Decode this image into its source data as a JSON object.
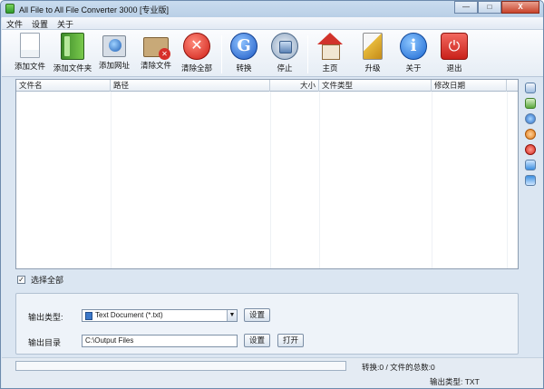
{
  "window": {
    "title": "All File to All File Converter 3000 [专业版]",
    "controls": {
      "minimize": "—",
      "maximize": "□",
      "close": "X"
    }
  },
  "menu": [
    "文件",
    "设置",
    "关于"
  ],
  "toolbar": {
    "add_file": "添加文件",
    "add_folder": "添加文件夹",
    "add_url": "添加网址",
    "clear_files": "清除文件",
    "clear_all": "清除全部",
    "convert": "转换",
    "stop": "停止",
    "home": "主页",
    "upgrade": "升级",
    "about": "关于",
    "exit": "退出"
  },
  "toolbar_glyphs": {
    "clear_all": "✕",
    "convert": "G",
    "about": "i"
  },
  "filelist": {
    "columns": [
      "文件名",
      "路径",
      "大小",
      "文件类型",
      "修改日期"
    ],
    "rows": []
  },
  "select_all": {
    "label": "选择全部",
    "checked": true,
    "mark": "✓"
  },
  "options": {
    "output_type_label": "输出类型:",
    "output_type_value": "Text Document (*.txt)",
    "output_dir_label": "输出目录",
    "output_dir_value": "C:\\Output Files",
    "settings_button": "设置",
    "open_button": "打开",
    "dropdown_arrow": "▼"
  },
  "status": {
    "progress": 0,
    "summary": "转换:0 / 文件的总数:0",
    "output_type": "输出类型: TXT"
  },
  "side_icons": [
    "list-icon",
    "image-icon",
    "globe-icon",
    "orange-circle-icon",
    "red-circle-icon",
    "arrow-up-icon",
    "arrow-down-icon"
  ]
}
